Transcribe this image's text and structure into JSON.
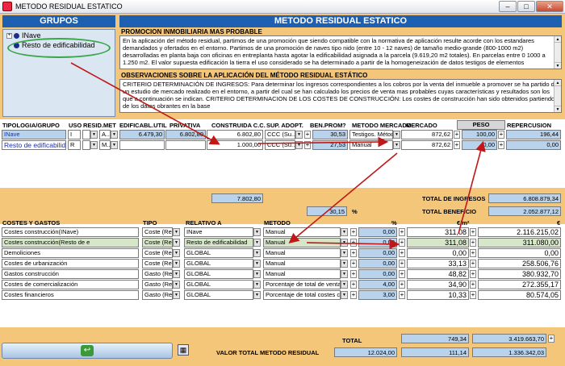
{
  "window": {
    "title": "METODO RESIDUAL ESTATICO"
  },
  "left": {
    "header": "GRUPOS",
    "tree": [
      {
        "label": "INave"
      },
      {
        "label": "Resto de edificabilidad"
      }
    ]
  },
  "right": {
    "header": "METODO RESIDUAL ESTATICO",
    "promo_title": "PROMOCION INMOBILIARIA MAS PROBABLE",
    "promo_text": "En la aplicación del método residual, partimos de una promoción que siendo compatible con la normativa de aplicación resulte acorde con los estandares demandados y ofertados en el entorno. Partimos de una promoción de naves tipo nido (entre 10 - 12 naves) de tamaño medio-grande (800-1000 m2) desarrolladas en planta baja con oficinas en entreplanta hasta agotar la edificabilidad asignada a la parcela (9.619,20 m2 totales). En parcelas entre 0 1000 a 1.250 m2. El valor supuesta edificación la tierra el uso considerado se ha determinado a partir de la homogeneización de datos testigos de elementos",
    "obs_title": "OBSERVACIONES SOBRE LA APLICACIÓN DEL MÉTODO RESIDUAL ESTÁTICO",
    "obs_text": "CRITERIO DETERMINACIÓN DE INGRESOS: Para determinar los ingresos correspondientes a los cobros por la venta del inmueble a promover se ha partido de un estudio de mercado realizado en el entorno, a partir del cual se han calculado los precios de venta mas probables cuyas características y resultados son los que a continuación se indican. CRITERIO DETERMINACION DE LOS COSTES DE CONSTRUCCIÓN: Los costes de construcción han sido obtenidos partiendo de los datos obrantes en la base"
  },
  "typology": {
    "headers": [
      "TIPOLOGIA/GRUPO",
      "USO",
      "RESID.",
      "MET",
      "EDIFICABL.UTIL",
      "PRIVATIVA",
      "CONSTRUIDA C.C.",
      "SUP. ADOPT.",
      "BEN.PROM",
      "METODO MERCADO",
      "MERCADO",
      "PESO",
      "REPERCUSION"
    ],
    "rows": [
      {
        "name": "INave",
        "uso": "I",
        "resid": "",
        "met": "A...",
        "edif_util": "6.479,30",
        "privativa": "6.802,80",
        "construida": "6.802,80",
        "sup_adopt": "CCC (Su...",
        "ben_prom": "30,53",
        "metodo": "Testigos. Métod",
        "mercado": "872,62",
        "peso": "100,00",
        "repercusion": "196,44"
      },
      {
        "name": "Resto de edificabilid",
        "uso": "R",
        "resid": "",
        "met": "M...",
        "edif_util": "",
        "privativa": "",
        "construida": "1.000,00",
        "sup_adopt": "CCC (Su...",
        "ben_prom": "27,53",
        "metodo": "Manual",
        "mercado": "872,62",
        "peso": "0,00",
        "repercusion": "0,00"
      }
    ],
    "total_construida": "7.802,80",
    "total_ingresos_label": "TOTAL DE INGRESOS",
    "total_ingresos": "6.808.879,34",
    "beneficio_pct": "30,15",
    "pct_sign": "%",
    "total_beneficio_label": "TOTAL BENEFICIO",
    "total_beneficio": "2.052.877,12"
  },
  "costs": {
    "headers": [
      "COSTES Y GASTOS",
      "TIPO",
      "RELATIVO A",
      "METODO",
      "%",
      "€/m²",
      "€"
    ],
    "rows": [
      {
        "name": "Costes construcción(INave)",
        "tipo": "Coste (Re",
        "relativo": "INave",
        "metodo": "Manual",
        "pct": "0,00",
        "eur_m2": "311,08",
        "eur": "2.116.215,02"
      },
      {
        "name": "Costes construcción(Resto de e",
        "tipo": "Coste (Re",
        "relativo": "Resto de edificabilidad",
        "metodo": "Manual",
        "pct": "0,00",
        "eur_m2": "311,08",
        "eur": "311.080,00"
      },
      {
        "name": "Demoliciones",
        "tipo": "Coste (Re",
        "relativo": "GLOBAL",
        "metodo": "Manual",
        "pct": "0,00",
        "eur_m2": "0,00",
        "eur": "0,00"
      },
      {
        "name": "Costes de urbanización",
        "tipo": "Coste (Re",
        "relativo": "GLOBAL",
        "metodo": "Manual",
        "pct": "0,00",
        "eur_m2": "33,13",
        "eur": "258.506,76"
      },
      {
        "name": "Gastos construcción",
        "tipo": "Gasto (Re",
        "relativo": "GLOBAL",
        "metodo": "Manual",
        "pct": "0,00",
        "eur_m2": "48,82",
        "eur": "380.932,70"
      },
      {
        "name": "Costes de comercialización",
        "tipo": "Gasto (Re",
        "relativo": "GLOBAL",
        "metodo": "Porcentaje de total de venta",
        "pct": "4,00",
        "eur_m2": "34,90",
        "eur": "272.355,17"
      },
      {
        "name": "Costes financieros",
        "tipo": "Gasto (Re",
        "relativo": "GLOBAL",
        "metodo": "Porcentaje de total costes c",
        "pct": "3,00",
        "eur_m2": "10,33",
        "eur": "80.574,05"
      }
    ],
    "total_label": "TOTAL",
    "total_eur_m2": "749,34",
    "total_eur": "3.419.663,70",
    "valor_label": "VALOR TOTAL METODO RESIDUAL",
    "valor_1": "12.024,00",
    "valor_2": "111,14",
    "valor_3": "1.336.342,03"
  },
  "colors": {
    "header_blue": "#1d5fb0",
    "panel_bg": "#f3c67a",
    "cell_blue": "#b9d3ec",
    "arrow_red": "#c01818",
    "ellipse_green": "#3aa64a"
  }
}
